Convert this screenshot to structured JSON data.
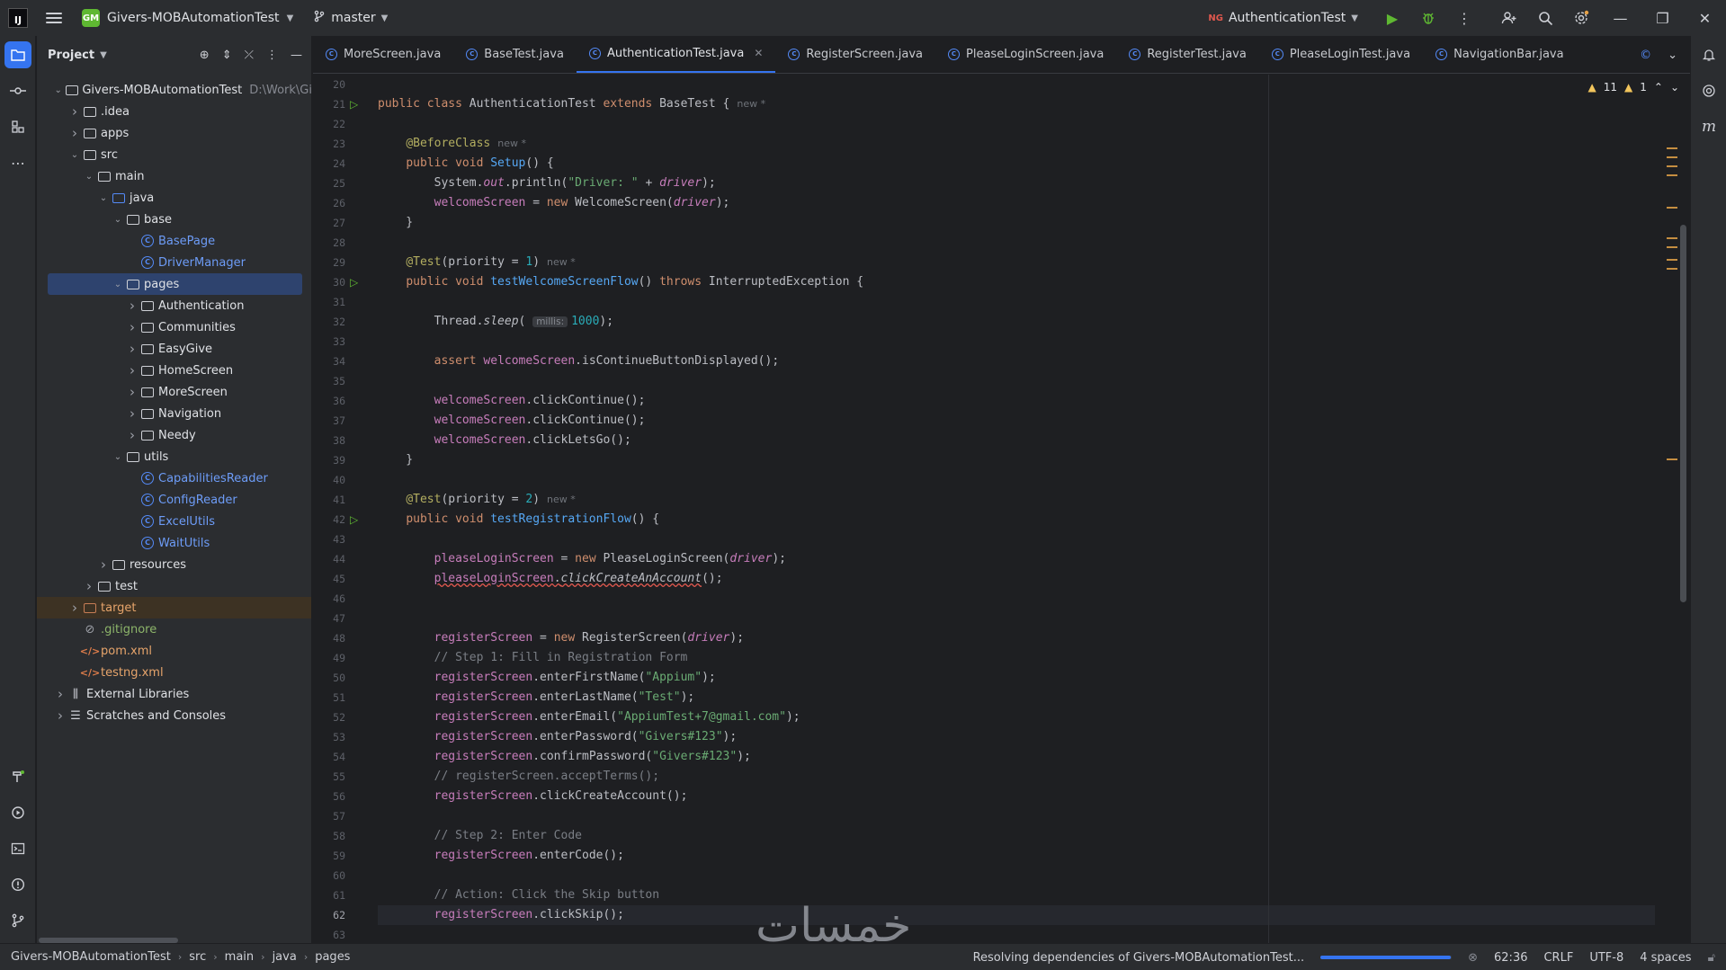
{
  "titlebar": {
    "app_logo": "IJ",
    "project_badge": "GM",
    "project_name": "Givers-MOBAutomationTest",
    "branch": "master",
    "run_config": "AuthenticationTest",
    "run_config_badge": "NG"
  },
  "project_panel": {
    "title": "Project",
    "root_name": "Givers-MOBAutomationTest",
    "root_path": "D:\\Work\\Gi",
    "tree": [
      {
        "label": "Givers-MOBAutomationTest",
        "type": "module"
      },
      {
        "label": ".idea",
        "type": "folder"
      },
      {
        "label": "apps",
        "type": "folder"
      },
      {
        "label": "src",
        "type": "folder"
      },
      {
        "label": "main",
        "type": "folder"
      },
      {
        "label": "java",
        "type": "source-folder"
      },
      {
        "label": "base",
        "type": "package"
      },
      {
        "label": "BasePage",
        "type": "class"
      },
      {
        "label": "DriverManager",
        "type": "class"
      },
      {
        "label": "pages",
        "type": "package"
      },
      {
        "label": "Authentication",
        "type": "package"
      },
      {
        "label": "Communities",
        "type": "package"
      },
      {
        "label": "EasyGive",
        "type": "package"
      },
      {
        "label": "HomeScreen",
        "type": "package"
      },
      {
        "label": "MoreScreen",
        "type": "package"
      },
      {
        "label": "Navigation",
        "type": "package"
      },
      {
        "label": "Needy",
        "type": "package"
      },
      {
        "label": "utils",
        "type": "package"
      },
      {
        "label": "CapabilitiesReader",
        "type": "class"
      },
      {
        "label": "ConfigReader",
        "type": "class"
      },
      {
        "label": "ExcelUtils",
        "type": "class"
      },
      {
        "label": "WaitUtils",
        "type": "class"
      },
      {
        "label": "resources",
        "type": "folder"
      },
      {
        "label": "test",
        "type": "folder"
      },
      {
        "label": "target",
        "type": "excluded-folder"
      },
      {
        "label": ".gitignore",
        "type": "file"
      },
      {
        "label": "pom.xml",
        "type": "xml"
      },
      {
        "label": "testng.xml",
        "type": "xml"
      },
      {
        "label": "External Libraries",
        "type": "libraries"
      },
      {
        "label": "Scratches and Consoles",
        "type": "scratches"
      }
    ]
  },
  "tabs": [
    {
      "label": "MoreScreen.java",
      "active": false
    },
    {
      "label": "BaseTest.java",
      "active": false
    },
    {
      "label": "AuthenticationTest.java",
      "active": true
    },
    {
      "label": "RegisterScreen.java",
      "active": false
    },
    {
      "label": "PleaseLoginScreen.java",
      "active": false
    },
    {
      "label": "RegisterTest.java",
      "active": false
    },
    {
      "label": "PleaseLoginTest.java",
      "active": false
    },
    {
      "label": "NavigationBar.java",
      "active": false
    }
  ],
  "inspections": {
    "warnings": "11",
    "weak_warnings": "1"
  },
  "code": {
    "line_numbers": [
      "20",
      "21",
      "22",
      "23",
      "24",
      "25",
      "26",
      "27",
      "28",
      "29",
      "30",
      "31",
      "32",
      "33",
      "34",
      "35",
      "36",
      "37",
      "38",
      "39",
      "40",
      "41",
      "42",
      "43",
      "44",
      "45",
      "46",
      "47",
      "48",
      "49",
      "50",
      "51",
      "52",
      "53",
      "54",
      "55",
      "56",
      "57",
      "58",
      "59",
      "60",
      "61",
      "62",
      "63"
    ],
    "new_hint": "new *",
    "millis_hint": "millis:",
    "current_line": "62"
  },
  "statusbar": {
    "crumbs": [
      "Givers-MOBAutomationTest",
      "src",
      "main",
      "java",
      "pages"
    ],
    "task": "Resolving dependencies of Givers-MOBAutomationTest...",
    "progress": 0.99,
    "position": "62:36",
    "line_sep": "CRLF",
    "encoding": "UTF-8",
    "indent": "4 spaces"
  },
  "watermark": "خمسات",
  "colors": {
    "accent": "#3574f0",
    "selection": "#2e436e",
    "run_green": "#5fb832",
    "warning": "#f2c55c"
  }
}
